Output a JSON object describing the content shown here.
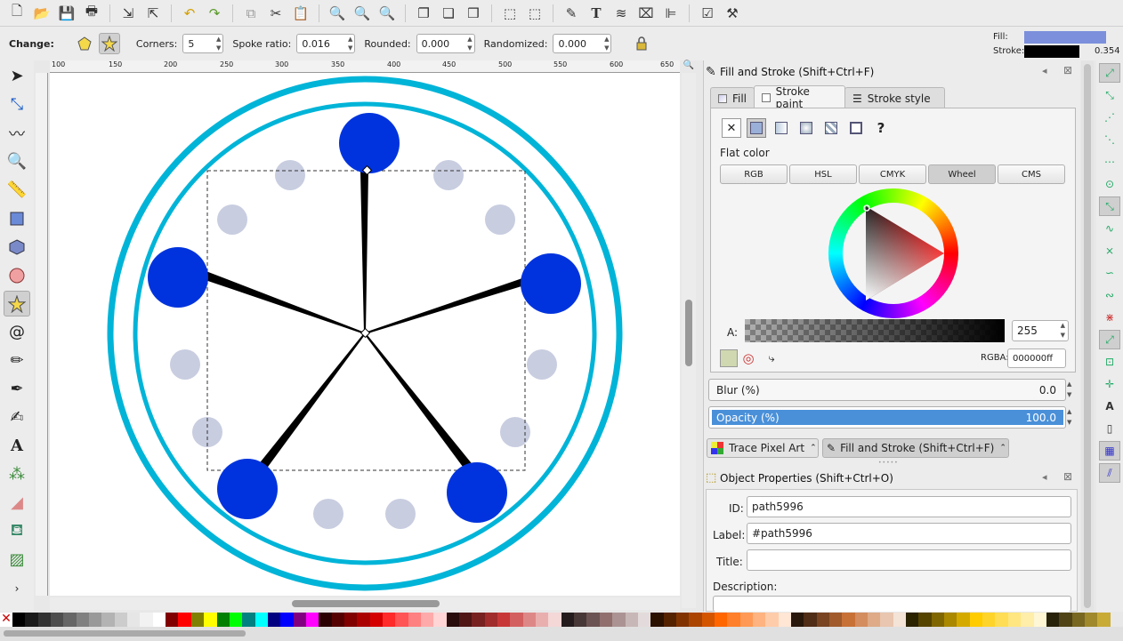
{
  "toolbar": {
    "icons": [
      "new-icon",
      "open-icon",
      "save-icon",
      "print-icon",
      "import-icon",
      "export-icon",
      "undo-icon",
      "redo-icon",
      "copy-icon",
      "cut-icon",
      "paste-icon",
      "zoom-selection-icon",
      "zoom-drawing-icon",
      "zoom-page-icon",
      "duplicate-icon",
      "clone-icon",
      "unlink-icon",
      "group-icon",
      "ungroup-icon",
      "fill-stroke-icon",
      "text-icon",
      "layers-icon",
      "xml-editor-icon",
      "align-icon",
      "document-properties-icon",
      "preferences-icon"
    ]
  },
  "controls": {
    "change_label": "Change:",
    "corners_label": "Corners:",
    "corners_value": "5",
    "spoke_label": "Spoke ratio:",
    "spoke_value": "0.016",
    "rounded_label": "Rounded:",
    "rounded_value": "0.000",
    "randomized_label": "Randomized:",
    "randomized_value": "0.000"
  },
  "indicator": {
    "fill_label": "Fill:",
    "stroke_label": "Stroke:",
    "stroke_width": "0.354",
    "fill_color": "#7b8fdc",
    "stroke_color": "#000000"
  },
  "rulers": {
    "h_ticks": [
      "100",
      "150",
      "200",
      "250",
      "300",
      "350",
      "400",
      "450",
      "500",
      "550",
      "600",
      "650"
    ]
  },
  "fill_stroke": {
    "title": "Fill and Stroke (Shift+Ctrl+F)",
    "tabs": [
      "Fill",
      "Stroke paint",
      "Stroke style"
    ],
    "flat_color_label": "Flat color",
    "modes": [
      "RGB",
      "HSL",
      "CMYK",
      "Wheel",
      "CMS"
    ],
    "alpha_label": "A:",
    "alpha_value": "255",
    "rgba_label": "RGBA:",
    "rgba_value": "000000ff",
    "blur_label": "Blur (%)",
    "blur_value": "0.0",
    "opacity_label": "Opacity (%)",
    "opacity_value": "100.0"
  },
  "dock_tabs": [
    "Trace Pixel Art",
    "Fill and Stroke (Shift+Ctrl+F)"
  ],
  "object_props": {
    "title": "Object Properties (Shift+Ctrl+O)",
    "id_label": "ID:",
    "id_value": "path5996",
    "label_label": "Label:",
    "label_value": "#path5996",
    "title_label": "Title:",
    "title_value": "",
    "description_label": "Description:"
  },
  "colors": {
    "accent_blue": "#0033dd",
    "ring_cyan": "#00b4d8",
    "dot_gray": "#c8cde0",
    "opacity_bar": "#4a90d9"
  },
  "palette": [
    "#000000",
    "#1a1a1a",
    "#333333",
    "#4d4d4d",
    "#666666",
    "#808080",
    "#999999",
    "#b3b3b3",
    "#cccccc",
    "#e6e6e6",
    "#f2f2f2",
    "#ffffff",
    "#800000",
    "#ff0000",
    "#808000",
    "#ffff00",
    "#008000",
    "#00ff00",
    "#008080",
    "#00ffff",
    "#000080",
    "#0000ff",
    "#800080",
    "#ff00ff",
    "#2b0000",
    "#550000",
    "#800000",
    "#aa0000",
    "#d40000",
    "#ff2a2a",
    "#ff5555",
    "#ff8080",
    "#ffaaaa",
    "#ffd5d5",
    "#280b0b",
    "#501616",
    "#782121",
    "#a02c2c",
    "#c83737",
    "#d35f5f",
    "#de8787",
    "#e9afaf",
    "#f4d7d7",
    "#241c1c",
    "#483737",
    "#6c5353",
    "#916f6f",
    "#ac9393",
    "#c8b7b7",
    "#e3dbdb",
    "#2b1100",
    "#552200",
    "#803300",
    "#aa4400",
    "#d45500",
    "#ff6600",
    "#ff7f2a",
    "#ff9955",
    "#ffb380",
    "#ffccaa",
    "#ffe6d5",
    "#28170b",
    "#502d16",
    "#784421",
    "#a05a2c",
    "#c87137",
    "#d38d5f",
    "#deaa87",
    "#e9c6af",
    "#f4e3d7",
    "#2b2200",
    "#554400",
    "#806600",
    "#aa8800",
    "#d4aa00",
    "#ffcc00",
    "#ffd42a",
    "#ffdd55",
    "#ffe680",
    "#ffeeaa",
    "#fff6d5",
    "#28220b",
    "#504416",
    "#786721",
    "#a0892c",
    "#c8ab37"
  ]
}
